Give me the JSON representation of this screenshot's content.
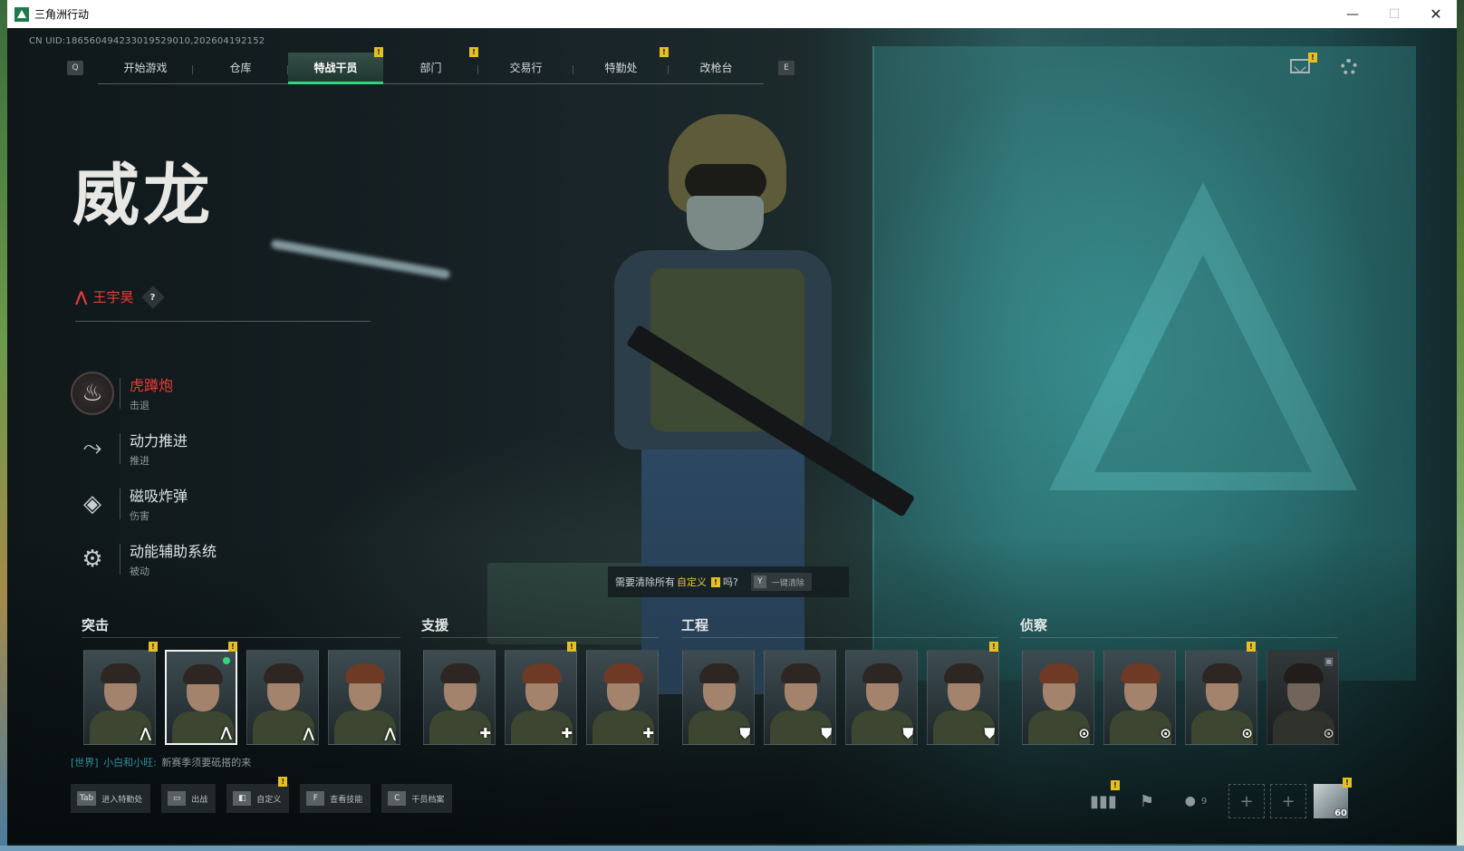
{
  "window": {
    "title": "三角洲行动",
    "minimize": "—",
    "maximize": "☐",
    "close": "✕"
  },
  "uid": "CN UID:18656049423301952901​0,202604192152",
  "nav": {
    "left_key": "Q",
    "right_key": "E",
    "tabs": [
      {
        "label": "开始游戏",
        "alert": false,
        "active": false
      },
      {
        "label": "仓库",
        "alert": false,
        "active": false
      },
      {
        "label": "特战干员",
        "alert": true,
        "active": true
      },
      {
        "label": "部门",
        "alert": true,
        "active": false
      },
      {
        "label": "交易行",
        "alert": false,
        "active": false
      },
      {
        "label": "特勤处",
        "alert": true,
        "active": false
      },
      {
        "label": "改枪台",
        "alert": false,
        "active": false
      }
    ]
  },
  "alert_mark": "!",
  "operator": {
    "codename": "威龙",
    "real_name": "王宇昊",
    "rank_icon": "chevron-up-icon",
    "help": "?"
  },
  "skills": [
    {
      "name": "虎蹲炮",
      "type": "击退",
      "icon": "mortar-icon",
      "glyph": "♨",
      "active": true
    },
    {
      "name": "动力推进",
      "type": "推进",
      "icon": "dash-icon",
      "glyph": "⤳",
      "active": false
    },
    {
      "name": "磁吸炸弹",
      "type": "伤害",
      "icon": "bomb-icon",
      "glyph": "◈",
      "active": false
    },
    {
      "name": "动能辅助系统",
      "type": "被动",
      "icon": "exo-icon",
      "glyph": "⚙",
      "active": false
    }
  ],
  "prompt": {
    "before": "需要清除所有",
    "highlight": "自定义",
    "after": "吗?",
    "key": "Y",
    "action": "一键清除"
  },
  "classes": {
    "assault": {
      "label": "突击",
      "role_glyph": "⋀"
    },
    "support": {
      "label": "支援",
      "role_glyph": "✚"
    },
    "engineer": {
      "label": "工程",
      "role_glyph": "⛊"
    },
    "recon": {
      "label": "侦察",
      "role_glyph": "⊙"
    }
  },
  "chat": {
    "channel": "[世界]",
    "sender": "小白和小旺:",
    "message": "新赛季须要砥搭的来"
  },
  "bottom_buttons": [
    {
      "key": "Tab",
      "label": "进入特勤处",
      "alert": false
    },
    {
      "key": "▭",
      "label": "出战",
      "alert": false
    },
    {
      "key": "◧",
      "label": "自定义",
      "alert": true
    },
    {
      "key": "F",
      "label": "查看技能",
      "alert": false
    },
    {
      "key": "C",
      "label": "干员档案",
      "alert": false
    }
  ],
  "bottom_right": {
    "stats_icon": "bar-chart-icon",
    "flag_icon": "flag-icon",
    "friends_count": "9",
    "slot_glyph": "+",
    "avatar_level": "60"
  },
  "colors": {
    "accent_green": "#2fd67c",
    "alert_yellow": "#e6c021",
    "highlight_red": "#ea3b39"
  }
}
